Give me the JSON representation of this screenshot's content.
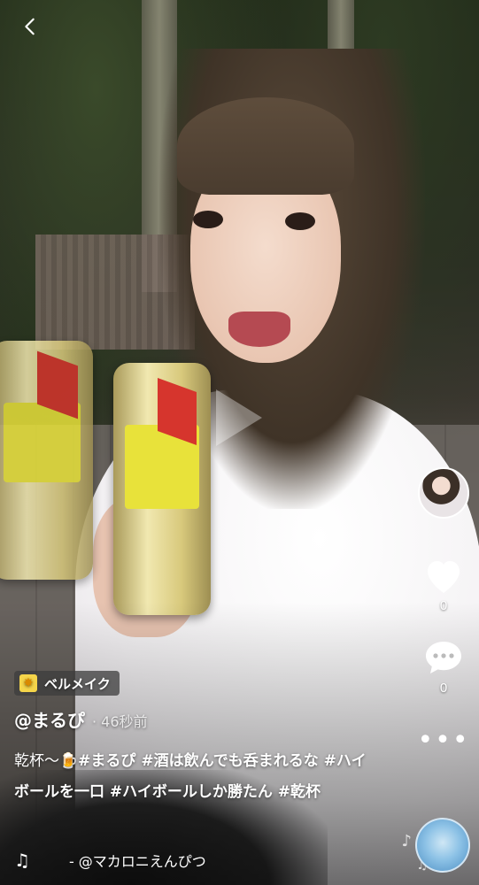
{
  "header": {
    "back_icon": "chevron-left-icon"
  },
  "effect": {
    "icon": "sparkle-icon",
    "label": "ベルメイク"
  },
  "post": {
    "username": "@まるぴ",
    "time": "· 46秒前",
    "caption_lead": "乾杯〜",
    "caption_emoji": "🍺",
    "hashtags": [
      "#まるぴ",
      "#酒は飲んでも呑まれるな",
      "#ハイボールを一口",
      "#ハイボールしか勝たん",
      "#乾杯"
    ]
  },
  "actions": {
    "like_icon": "heart-icon",
    "like_count": "0",
    "comment_icon": "comment-bubble-icon",
    "comment_count": "0",
    "more_icon": "more-dots-icon",
    "more_label": "•••"
  },
  "music": {
    "icon": "music-note-icon",
    "note_glyph": "♫",
    "song": "- @マカロニえんぴつ"
  },
  "colors": {
    "text": "#ffffff",
    "effect_bg": "#3c3c3c",
    "effect_icon": "#f5d54a"
  }
}
